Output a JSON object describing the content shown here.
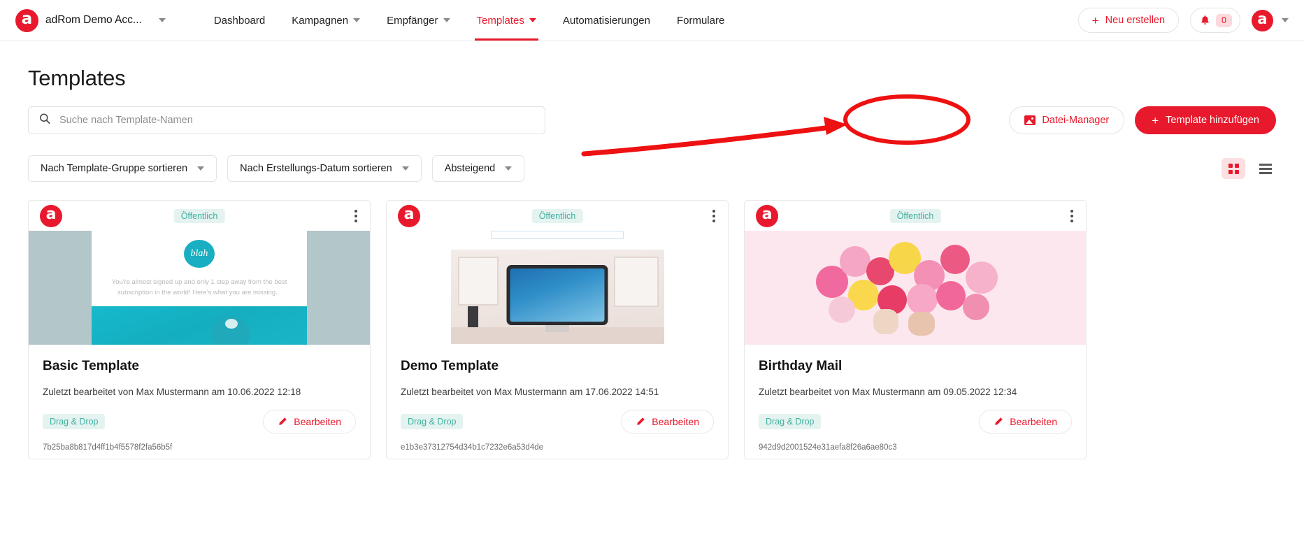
{
  "header": {
    "brand_name": "adRom Demo Acc...",
    "logo_letter": "a",
    "menu": [
      {
        "label": "Dashboard",
        "has_caret": false,
        "active": false
      },
      {
        "label": "Kampagnen",
        "has_caret": true,
        "active": false
      },
      {
        "label": "Empfänger",
        "has_caret": true,
        "active": false
      },
      {
        "label": "Templates",
        "has_caret": true,
        "active": true
      },
      {
        "label": "Automatisierungen",
        "has_caret": false,
        "active": false
      },
      {
        "label": "Formulare",
        "has_caret": false,
        "active": false
      }
    ],
    "new_button": "Neu erstellen",
    "notification_count": "0",
    "avatar_letter": "a"
  },
  "page": {
    "title": "Templates"
  },
  "search": {
    "placeholder": "Suche nach Template-Namen",
    "value": ""
  },
  "actions": {
    "file_manager": "Datei-Manager",
    "add_template": "Template hinzufügen"
  },
  "filters": [
    {
      "label": "Nach Template-Gruppe sortieren"
    },
    {
      "label": "Nach Erstellungs-Datum sortieren"
    },
    {
      "label": "Absteigend"
    }
  ],
  "view": {
    "grid_active": true,
    "list_active": false
  },
  "cards": [
    {
      "visibility_badge": "Öffentlich",
      "title": "Basic Template",
      "meta": "Zuletzt bearbeitet von Max Mustermann am 10.06.2022 12:18",
      "type_badge": "Drag & Drop",
      "edit_label": "Bearbeiten",
      "hash": "7b25ba8b817d4ff1b4f5578f2fa56b5f",
      "preview_logo": "blah",
      "preview_text": "You're almost signed up and only 1 step away from the best subscription in the world! Here's what you are missing..."
    },
    {
      "visibility_badge": "Öffentlich",
      "title": "Demo Template",
      "meta": "Zuletzt bearbeitet von Max Mustermann am 17.06.2022 14:51",
      "type_badge": "Drag & Drop",
      "edit_label": "Bearbeiten",
      "hash": "e1b3e37312754d34b1c7232e6a53d4de"
    },
    {
      "visibility_badge": "Öffentlich",
      "title": "Birthday Mail",
      "meta": "Zuletzt bearbeitet von Max Mustermann am 09.05.2022 12:34",
      "type_badge": "Drag & Drop",
      "edit_label": "Bearbeiten",
      "hash": "942d9d2001524e31aefa8f26a6ae80c3"
    }
  ],
  "colors": {
    "brand_red": "#e8192c",
    "badge_teal": "#3fb0a0",
    "badge_teal_bg": "#e4f3f0",
    "annotation_red": "#ee1111"
  }
}
